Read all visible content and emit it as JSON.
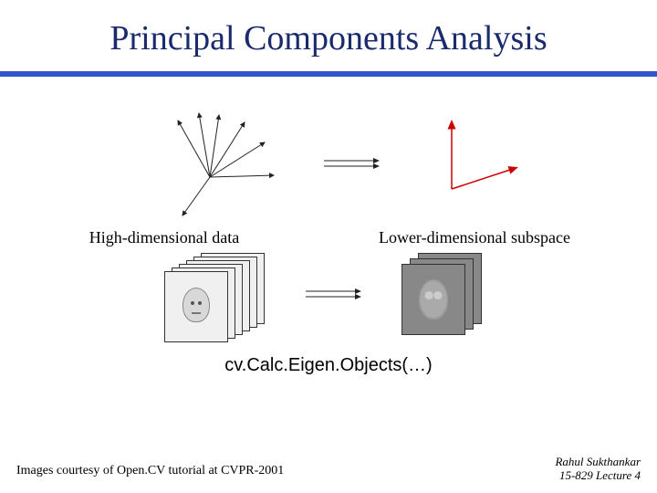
{
  "title": "Principal Components Analysis",
  "label_high": "High-dimensional data",
  "label_low": "Lower-dimensional subspace",
  "function_name": "cv.Calc.Eigen.Objects(…)",
  "footer_credit": "Images courtesy of Open.CV tutorial at CVPR-2001",
  "footer_author": "Rahul Sukthankar",
  "footer_course": "15-829 Lecture 4",
  "diagram": {
    "high_dim_arrows": 7,
    "low_dim_axes": 2,
    "face_stack_count": 6,
    "eigen_stack_count": 3
  }
}
